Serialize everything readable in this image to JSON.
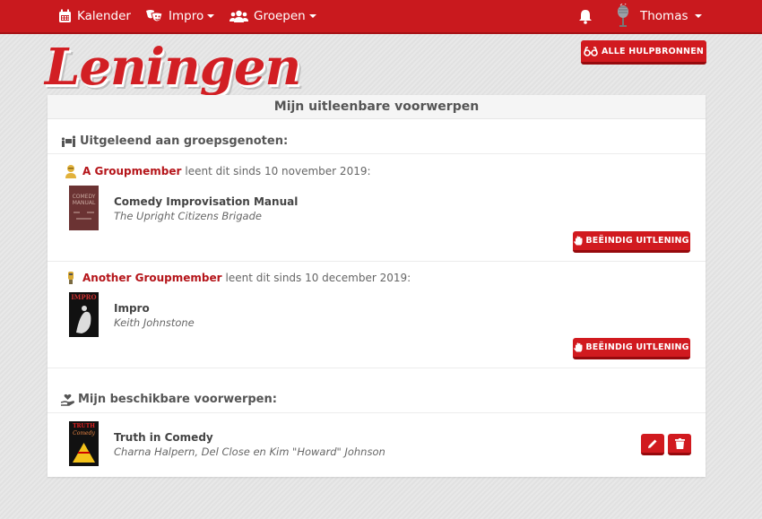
{
  "navbar": {
    "items": [
      {
        "label": "Kalender",
        "icon": "calendar-icon",
        "dropdown": false
      },
      {
        "label": "Impro",
        "icon": "theater-masks-icon",
        "dropdown": true
      },
      {
        "label": "Groepen",
        "icon": "users-icon",
        "dropdown": true
      }
    ],
    "notifications_icon": "bell-icon",
    "user": {
      "name": "Thomas",
      "avatar": "microphone-avatar",
      "dropdown": true
    }
  },
  "page": {
    "title": "Leningen",
    "resources_button": "Alle hulpbronnen",
    "resources_icon": "glasses-icon"
  },
  "card": {
    "header": "Mijn uitleenbare voorwerpen",
    "lent_section": {
      "title": "Uitgeleend aan groepsgenoten:",
      "icon": "people-carry-icon",
      "loans": [
        {
          "member": "A Groupmember",
          "text": "leent dit sinds 10 november 2019:",
          "book_title": "Comedy Improvisation Manual",
          "book_author": "The Upright Citizens Brigade",
          "cover_label": "COMEDY MANUAL",
          "end_button": "Beëindig uitlening"
        },
        {
          "member": "Another Groupmember",
          "text": "leent dit sinds 10 december 2019:",
          "book_title": "Impro",
          "book_author": "Keith Johnstone",
          "cover_label": "IMPRO",
          "end_button": "Beëindig uitlening"
        }
      ]
    },
    "available_section": {
      "title": "Mijn beschikbare voorwerpen:",
      "icon": "hand-holding-heart-icon",
      "items": [
        {
          "book_title": "Truth in Comedy",
          "book_author": "Charna Halpern, Del Close en Kim \"Howard\" Johnson",
          "cover_label": "TRUTH IN COMEDY",
          "edit_icon": "pencil-icon",
          "delete_icon": "trash-icon"
        }
      ]
    }
  },
  "colors": {
    "brand_red": "#c9191e",
    "member_link": "#b5151a"
  }
}
